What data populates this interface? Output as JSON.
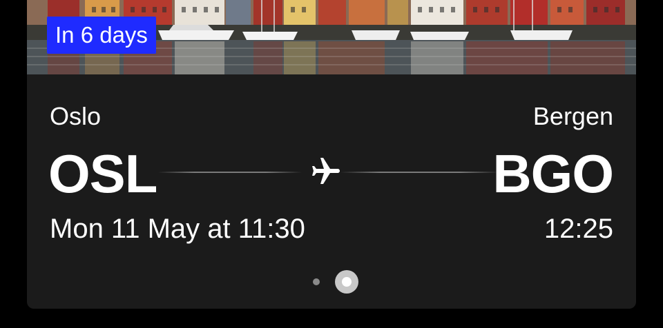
{
  "trip_card": {
    "badge": "In 6 days",
    "origin": {
      "city": "Oslo",
      "code": "OSL",
      "departure": "Mon 11 May at 11:30"
    },
    "destination": {
      "city": "Bergen",
      "code": "BGO",
      "arrival": "12:25"
    },
    "route_icon": "airplane-icon",
    "pagination": {
      "total_pages": 2,
      "active_page": 2
    }
  },
  "colors": {
    "card_background": "#1b1b1b",
    "badge_background": "#1f2bff",
    "text": "#ffffff"
  }
}
